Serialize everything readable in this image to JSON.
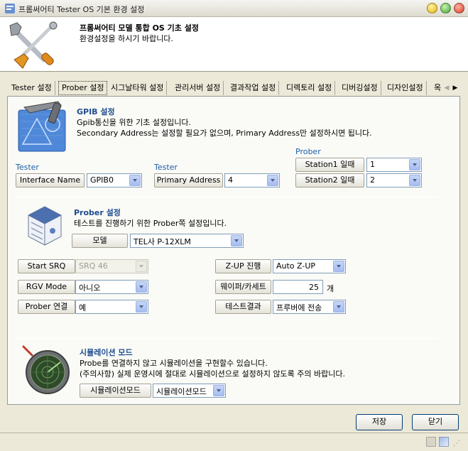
{
  "window": {
    "title": "프롬써어티 Tester OS 기본 환경 설정"
  },
  "banner": {
    "title": "프롬써어티 모델 통합 OS 기초 설정",
    "subtitle": "환경설정을 하시기 바랍니다."
  },
  "tabs": [
    {
      "label": "Tester 설정"
    },
    {
      "label": "Prober 설정"
    },
    {
      "label": "시그날타워 설정"
    },
    {
      "label": "관리서버 설정"
    },
    {
      "label": "결과작업 설정"
    },
    {
      "label": "디렉토리 설정"
    },
    {
      "label": "디버깅설정"
    },
    {
      "label": "디자인설정"
    },
    {
      "label": "옥"
    }
  ],
  "gpib": {
    "title": "GPIB 설정",
    "desc1": "Gpib통신을 위한 기초 설정입니다.",
    "desc2": "Secondary Address는 설정할 필요가 없으며, Primary Address만 설정하시면 됩니다.",
    "tester_label_1": "Tester",
    "tester_label_2": "Tester",
    "prober_label": "Prober",
    "interface_label": "Interface Name",
    "interface_value": "GPIB0",
    "primary_label": "Primary Address",
    "primary_value": "4",
    "station1_label": "Station1 일때",
    "station1_value": "1",
    "station2_label": "Station2 일때",
    "station2_value": "2"
  },
  "prober": {
    "title": "Prober 설정",
    "desc": "테스트를 진행하기 위한 Prober쪽 설정입니다.",
    "model_label": "모델",
    "model_value": "TEL사 P-12XLM",
    "start_srq_label": "Start SRQ",
    "start_srq_value": "SRQ 46",
    "rgv_label": "RGV Mode",
    "rgv_value": "아니오",
    "connect_label": "Prober 연결",
    "connect_value": "예",
    "zup_label": "Z-UP 진행",
    "zup_value": "Auto Z-UP",
    "wafer_label": "웨이퍼/카세트",
    "wafer_value": "25",
    "wafer_unit": "개",
    "result_label": "테스트결과",
    "result_value": "프루버에 전송"
  },
  "simulation": {
    "title": "시뮬레이션 모드",
    "desc1": "Probe를 연결하지 않고 시뮬레이션을 구현할수 있습니다.",
    "desc2": "(주의사항) 실제 운영시에 절대로 시뮬레이션으로 설정하지 않도록 주의 바랍니다.",
    "mode_label": "시뮬레이션모드",
    "mode_value": "시뮬레이션모드"
  },
  "footer": {
    "save": "저장",
    "close": "닫기"
  },
  "colors": {
    "accent": "#1f4d8f",
    "panel": "#fafaf6",
    "window": "#ece9d8"
  },
  "icons": [
    "app-icon",
    "tools-icon",
    "blueprint-icon",
    "server-icon",
    "radar-icon",
    "minimize-icon",
    "maximize-icon",
    "close-icon",
    "tab-left-arrow-icon",
    "tab-right-arrow-icon"
  ]
}
